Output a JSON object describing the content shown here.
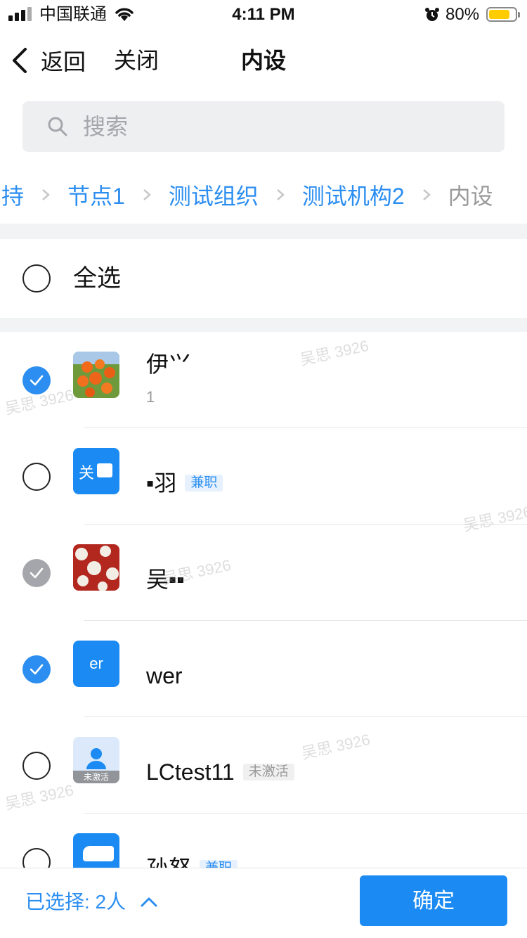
{
  "status_bar": {
    "carrier": "中国联通",
    "time": "4:11 PM",
    "battery_percent": "80%",
    "battery_color": "#ffcc00"
  },
  "nav": {
    "back_label": "返回",
    "close_label": "关闭",
    "title": "内设"
  },
  "search": {
    "placeholder": "搜索",
    "icon": "search-icon"
  },
  "breadcrumb": [
    "持",
    "节点1",
    "测试组织",
    "测试机构2",
    "内设"
  ],
  "select_all": {
    "label": "全选",
    "checked": false
  },
  "contacts": [
    {
      "name": "伊⺍",
      "subline": "1",
      "state": "checked",
      "avatar": "orange-fruit-photo"
    },
    {
      "name": "▪羽",
      "tag": "兼职",
      "tag_style": "blue",
      "state": "unchecked",
      "avatar_text": "关"
    },
    {
      "name": "吴▪▪",
      "state": "checked-disabled",
      "avatar": "red-white-dots-photo"
    },
    {
      "name": "wer",
      "state": "checked",
      "avatar_text": "er"
    },
    {
      "name": "LCtest11",
      "tag": "未激活",
      "tag_style": "gray",
      "state": "unchecked",
      "avatar_badge": "未激活"
    },
    {
      "name": "孙怒",
      "tag": "兼职",
      "tag_style": "blue",
      "state": "unchecked",
      "avatar_text": ""
    }
  ],
  "footer": {
    "selected_label": "已选择: 2人",
    "confirm_label": "确定"
  },
  "watermark": "吴思 3926",
  "colors": {
    "accent": "#2b8ef0",
    "button": "#1b8bf3",
    "disabled_check": "#a5a6ab"
  }
}
